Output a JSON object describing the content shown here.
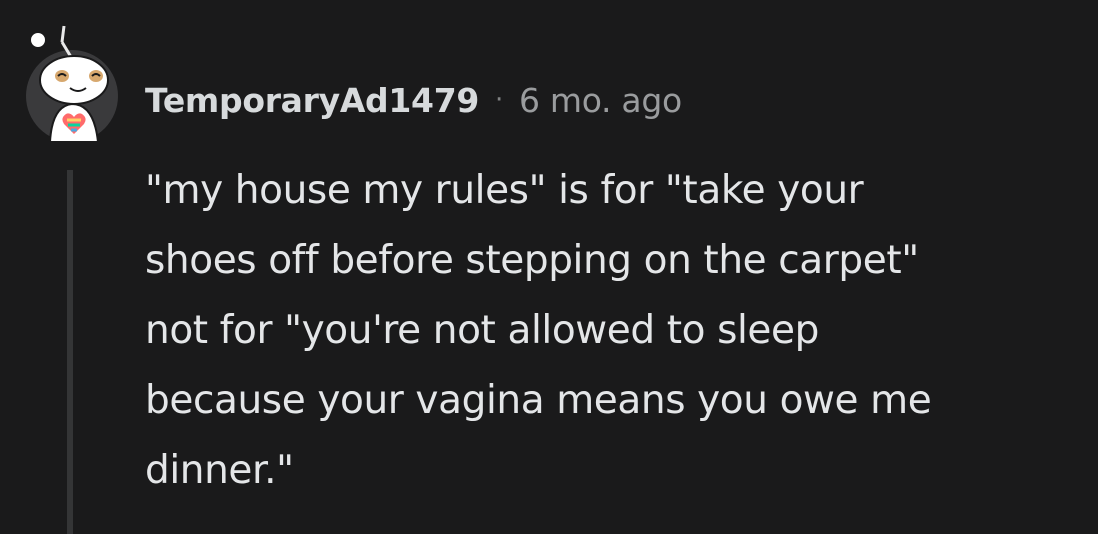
{
  "comment": {
    "author": "TemporaryAd1479",
    "separator": "·",
    "timestamp": "6 mo. ago",
    "avatar_icon": "snoo-avatar-icon",
    "body_lines": [
      "\"my house my rules\" is for \"take your",
      "shoes off before stepping on the carpet\"",
      "not for \"you're not allowed to sleep",
      "because your vagina means you owe me",
      "dinner.\""
    ]
  },
  "colors": {
    "background": "#1a1a1b",
    "text": "#d7dadc",
    "muted": "#9a9c9e",
    "thread_line": "#343536"
  }
}
